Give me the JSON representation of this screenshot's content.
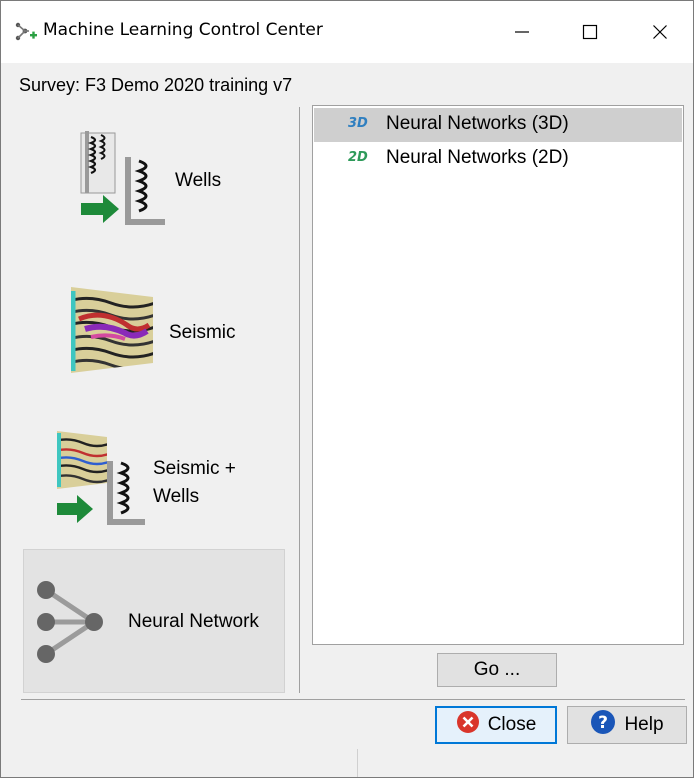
{
  "window": {
    "title": "Machine Learning Control Center",
    "icon": "network-plus-icon"
  },
  "titlebar_buttons": {
    "minimize_icon": "minimize-icon",
    "maximize_icon": "maximize-icon",
    "close_icon": "close-icon"
  },
  "survey": {
    "label": "Survey: F3 Demo 2020 training v7"
  },
  "tools": [
    {
      "label": "Wells",
      "icon": "wells-icon",
      "selected": false
    },
    {
      "label": "Seismic",
      "icon": "seismic-icon",
      "selected": false
    },
    {
      "label_line1": "Seismic +",
      "label_line2": "Wells",
      "icon": "seismic-wells-icon",
      "selected": false
    },
    {
      "label": "Neural Network",
      "icon": "neural-network-icon",
      "selected": true
    }
  ],
  "methods": [
    {
      "badge": "3D",
      "label": "Neural Networks (3D)",
      "selected": true,
      "badge_color": "#2f7fc0"
    },
    {
      "badge": "2D",
      "label": "Neural Networks (2D)",
      "selected": false,
      "badge_color": "#2e9a5a"
    }
  ],
  "actions": {
    "go_label": "Go ...",
    "close_label": "Close",
    "help_label": "Help"
  },
  "colors": {
    "selection": "#cfcfcf",
    "close_icon_red": "#d9352b",
    "help_icon_blue": "#1a56b8",
    "arrow_green": "#1e8a3a"
  }
}
